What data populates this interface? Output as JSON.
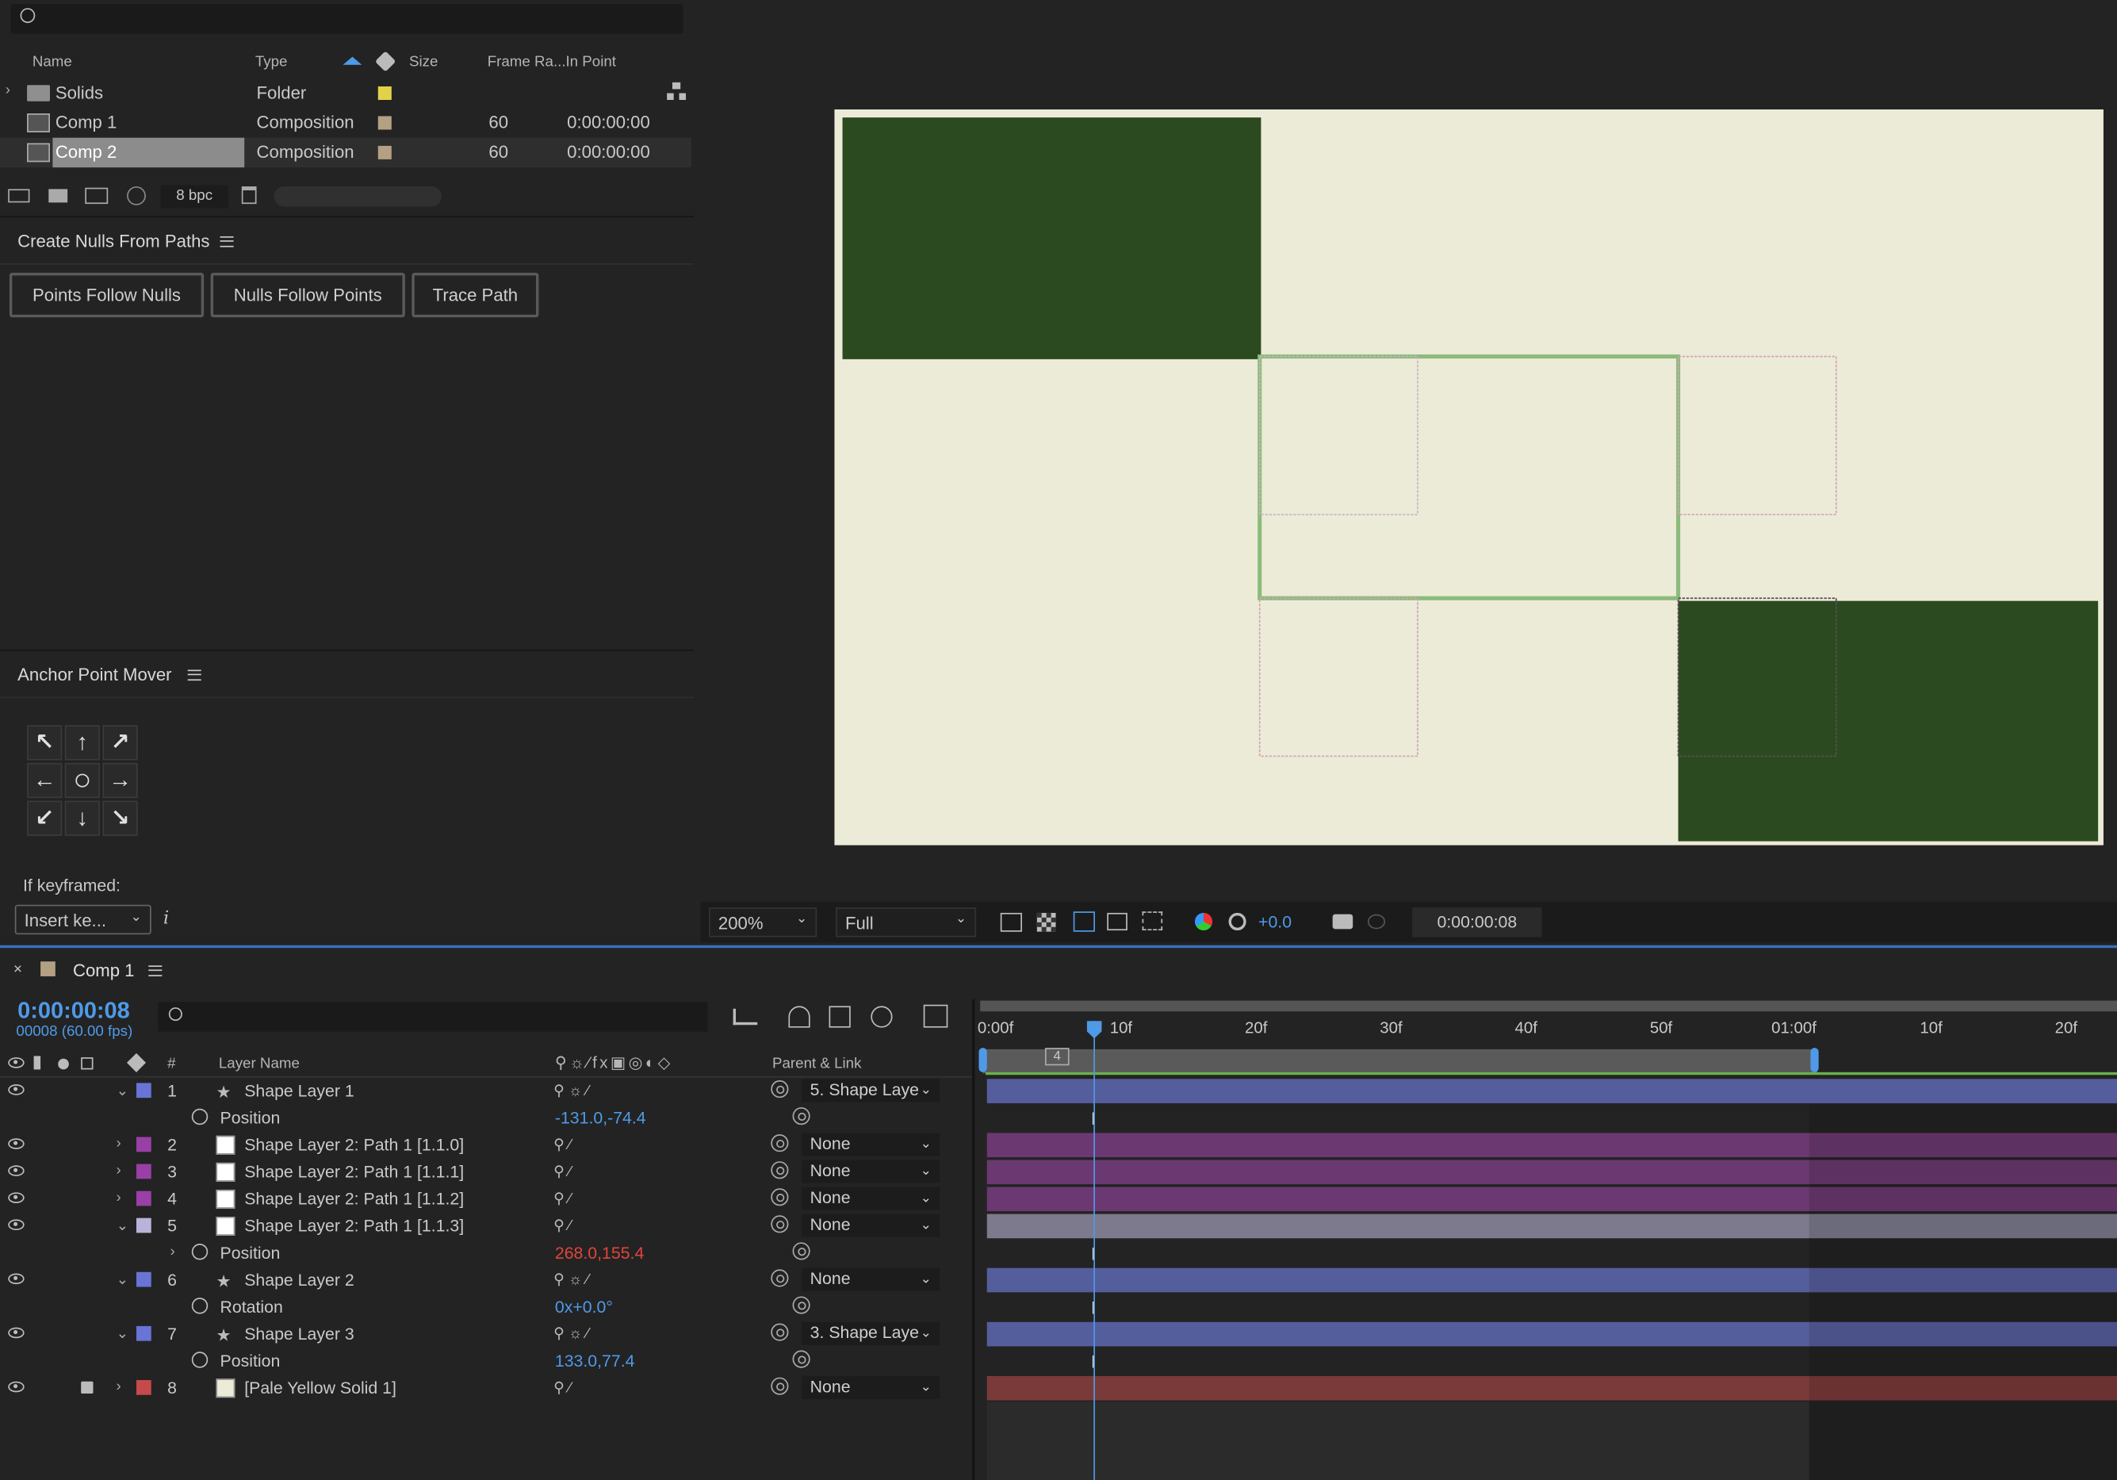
{
  "project": {
    "columns": {
      "name": "Name",
      "type": "Type",
      "size": "Size",
      "frame_rate": "Frame Ra...",
      "in_point": "In Point"
    },
    "items": [
      {
        "name": "Solids",
        "type": "Folder",
        "frame_rate": "",
        "in_point": "",
        "label_color": "#e2d24a"
      },
      {
        "name": "Comp 1",
        "type": "Composition",
        "frame_rate": "60",
        "in_point": "0:00:00:00",
        "label_color": "#b4a082"
      },
      {
        "name": "Comp 2",
        "type": "Composition",
        "frame_rate": "60",
        "in_point": "0:00:00:00",
        "label_color": "#b4a082"
      }
    ],
    "bpc": "8 bpc"
  },
  "nulls_panel": {
    "title": "Create Nulls From Paths",
    "buttons": [
      "Points Follow Nulls",
      "Nulls Follow Points",
      "Trace Path"
    ]
  },
  "anchor_panel": {
    "title": "Anchor Point Mover",
    "keyframe_label": "If keyframed:",
    "keyframe_value": "Insert ke..."
  },
  "viewer": {
    "zoom": "200%",
    "resolution": "Full",
    "exposure": "+0.0",
    "timecode": "0:00:00:08",
    "bg_color": "#ecebd7",
    "shape_color": "#2c4a20"
  },
  "timeline": {
    "title": "Comp 1",
    "timecode": "0:00:00:08",
    "frame_info": "00008 (60.00 fps)",
    "headers": {
      "num": "#",
      "layer_name": "Layer Name",
      "parent": "Parent & Link"
    },
    "ruler": [
      "0:00f",
      "10f",
      "20f",
      "30f",
      "40f",
      "50f",
      "01:00f",
      "10f",
      "20f"
    ],
    "marker": "4",
    "rows": [
      {
        "num": "1",
        "name": "Shape Layer 1",
        "parent": "5. Shape Laye",
        "color": "#6a74d6",
        "star": true
      },
      {
        "prop": "Position",
        "value": "-131.0,-74.4",
        "value_color": "#4f9ae8"
      },
      {
        "num": "2",
        "name": "Shape Layer 2: Path 1 [1.1.0]",
        "parent": "None",
        "color": "#9a3fa6"
      },
      {
        "num": "3",
        "name": "Shape Layer 2: Path 1 [1.1.1]",
        "parent": "None",
        "color": "#9a3fa6"
      },
      {
        "num": "4",
        "name": "Shape Layer 2: Path 1 [1.1.2]",
        "parent": "None",
        "color": "#9a3fa6"
      },
      {
        "num": "5",
        "name": "Shape Layer 2: Path 1 [1.1.3]",
        "parent": "None",
        "color": "#b8b3d8"
      },
      {
        "prop": "Position",
        "value": "268.0,155.4",
        "value_color": "#e2453a"
      },
      {
        "num": "6",
        "name": "Shape Layer 2",
        "parent": "None",
        "color": "#6a74d6",
        "star": true
      },
      {
        "prop": "Rotation",
        "value": "0x+0.0°",
        "value_color": "#4f9ae8"
      },
      {
        "num": "7",
        "name": "Shape Layer 3",
        "parent": "3. Shape Laye",
        "color": "#6a74d6",
        "star": true
      },
      {
        "prop": "Position",
        "value": "133.0,77.4",
        "value_color": "#4f9ae8"
      },
      {
        "num": "8",
        "name": "[Pale Yellow Solid 1]",
        "parent": "None",
        "color": "#c64a4a",
        "solid": true
      }
    ]
  }
}
